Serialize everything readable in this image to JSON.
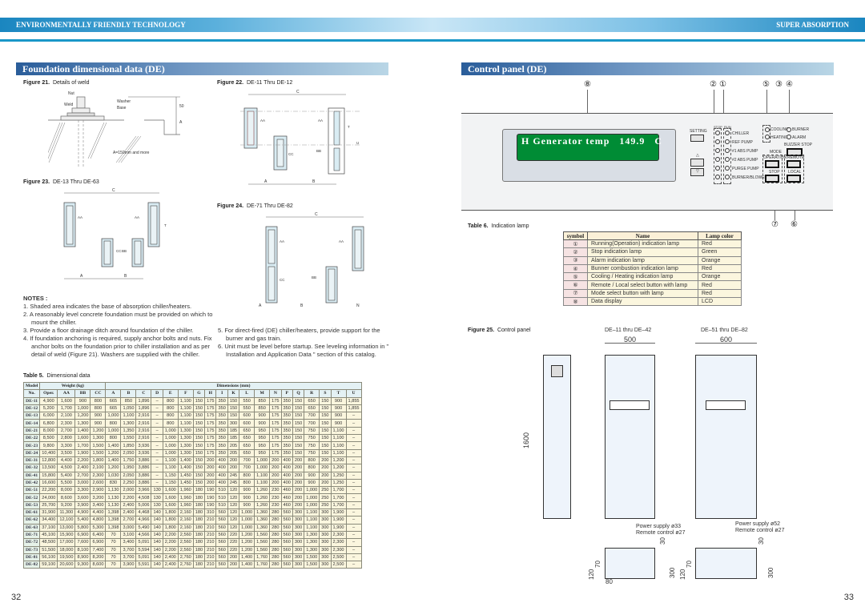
{
  "header": {
    "left_title": "ENVIRONMENTALLY FRIENDLY TECHNOLOGY",
    "right_title": "SUPER ABSORPTION"
  },
  "left_page": {
    "section_title": "Foundation dimensional data (DE)",
    "figures": {
      "fig21": {
        "num": "Figure 21.",
        "caption": "Details of weld",
        "labels": {
          "nut": "Nut",
          "weld": "Weld",
          "washer": "Washer",
          "base": "Base",
          "dim_50": "50",
          "dim_a": "A",
          "note": "A=150mm and more"
        }
      },
      "fig22": {
        "num": "Figure 22.",
        "caption": "DE-11 Thru DE-12"
      },
      "fig23": {
        "num": "Figure 23.",
        "caption": "DE-13 Thru DE-63"
      },
      "fig24": {
        "num": "Figure 24.",
        "caption": "DE-71 Thru DE-82"
      }
    },
    "notes": {
      "heading": "NOTES :",
      "items": [
        "1.  Shaded area indicates the base of absorption chiller/heaters.",
        "2.  A reasonably level concrete foundation must be provided on which to mount the chiller.",
        "3.  Provide a floor drainage ditch around foundation of the chiller.",
        "4.  If foundation anchoring is required, supply anchor bolts and nuts. Fix anchor bolts on the foundation prior to chiller installation and as per detail of weld (Figure 21). Washers are supplied with the chiller.",
        "5.  For direct-fired (DE) chiller/heaters, provide support for the burner and gas train.",
        "6.  Unit must be level before startup. See leveling information in \" Installation and Application Data \" section of this catalog."
      ]
    },
    "table5": {
      "num": "Table 5.",
      "caption": "Dimensional data",
      "group_headers": {
        "model": "Model",
        "model2": "No.",
        "weight": "Weight (kg)",
        "dims": "Dimensions (mm)"
      },
      "columns": [
        "Oper.",
        "AA",
        "BB",
        "CC",
        "A",
        "B",
        "C",
        "D",
        "E",
        "F",
        "G",
        "H",
        "I",
        "K",
        "L",
        "M",
        "N",
        "P",
        "Q",
        "R",
        "S",
        "T",
        "U"
      ],
      "rows": [
        {
          "model": "DE-11",
          "values": [
            "4,900",
            "1,600",
            "900",
            "800",
            "665",
            "850",
            "1,896",
            "–",
            "800",
            "1,100",
            "150",
            "175",
            "350",
            "150",
            "550",
            "850",
            "175",
            "350",
            "150",
            "650",
            "150",
            "900",
            "1,855"
          ]
        },
        {
          "model": "DE-12",
          "values": [
            "5,200",
            "1,700",
            "1,000",
            "800",
            "665",
            "1,050",
            "1,896",
            "–",
            "800",
            "1,100",
            "150",
            "175",
            "350",
            "150",
            "550",
            "850",
            "175",
            "350",
            "150",
            "650",
            "150",
            "900",
            "1,855"
          ]
        },
        {
          "model": "DE-13",
          "values": [
            "6,000",
            "2,100",
            "1,200",
            "900",
            "1,000",
            "1,100",
            "2,916",
            "–",
            "800",
            "1,100",
            "150",
            "175",
            "350",
            "150",
            "600",
            "900",
            "175",
            "350",
            "150",
            "700",
            "150",
            "900",
            "–"
          ]
        },
        {
          "model": "DE-14",
          "values": [
            "6,800",
            "2,300",
            "1,300",
            "900",
            "800",
            "1,300",
            "2,916",
            "–",
            "800",
            "1,100",
            "150",
            "175",
            "350",
            "300",
            "600",
            "900",
            "175",
            "350",
            "150",
            "700",
            "150",
            "900",
            "–"
          ]
        },
        {
          "model": "DE-21",
          "values": [
            "8,000",
            "2,700",
            "1,400",
            "1,200",
            "1,000",
            "1,350",
            "2,916",
            "–",
            "1,000",
            "1,300",
            "150",
            "175",
            "350",
            "185",
            "650",
            "950",
            "175",
            "350",
            "150",
            "750",
            "150",
            "1,100",
            "–"
          ]
        },
        {
          "model": "DE-22",
          "values": [
            "8,500",
            "2,800",
            "1,600",
            "1,300",
            "800",
            "1,550",
            "2,916",
            "–",
            "1,000",
            "1,300",
            "150",
            "175",
            "350",
            "185",
            "650",
            "950",
            "175",
            "350",
            "150",
            "750",
            "150",
            "1,100",
            "–"
          ]
        },
        {
          "model": "DE-23",
          "values": [
            "9,800",
            "3,300",
            "1,700",
            "1,500",
            "1,400",
            "1,850",
            "3,936",
            "–",
            "1,000",
            "1,300",
            "150",
            "175",
            "350",
            "205",
            "650",
            "950",
            "175",
            "350",
            "150",
            "750",
            "150",
            "1,100",
            "–"
          ]
        },
        {
          "model": "DE-24",
          "values": [
            "10,400",
            "3,500",
            "1,900",
            "1,500",
            "1,200",
            "2,050",
            "3,936",
            "–",
            "1,000",
            "1,300",
            "150",
            "175",
            "350",
            "205",
            "650",
            "950",
            "175",
            "350",
            "150",
            "750",
            "150",
            "1,100",
            "–"
          ]
        },
        {
          "model": "DE-31",
          "values": [
            "12,800",
            "4,400",
            "2,200",
            "1,800",
            "1,400",
            "1,750",
            "3,886",
            "–",
            "1,100",
            "1,400",
            "150",
            "200",
            "400",
            "200",
            "700",
            "1,000",
            "200",
            "400",
            "200",
            "800",
            "200",
            "1,200",
            "–"
          ]
        },
        {
          "model": "DE-32",
          "values": [
            "13,500",
            "4,500",
            "2,400",
            "2,100",
            "1,200",
            "1,950",
            "3,886",
            "–",
            "1,100",
            "1,400",
            "150",
            "200",
            "400",
            "200",
            "700",
            "1,000",
            "200",
            "400",
            "200",
            "800",
            "200",
            "1,200",
            "–"
          ]
        },
        {
          "model": "DE-41",
          "values": [
            "15,800",
            "5,400",
            "2,700",
            "2,300",
            "1,030",
            "2,050",
            "3,886",
            "–",
            "1,150",
            "1,450",
            "150",
            "200",
            "400",
            "245",
            "800",
            "1,100",
            "200",
            "400",
            "200",
            "900",
            "200",
            "1,250",
            "–"
          ]
        },
        {
          "model": "DE-42",
          "values": [
            "16,600",
            "5,500",
            "3,000",
            "2,600",
            "830",
            "2,250",
            "3,886",
            "–",
            "1,150",
            "1,450",
            "150",
            "200",
            "400",
            "245",
            "800",
            "1,100",
            "200",
            "400",
            "200",
            "900",
            "200",
            "1,250",
            "–"
          ]
        },
        {
          "model": "DE-51",
          "values": [
            "22,200",
            "8,000",
            "3,300",
            "2,900",
            "1,130",
            "2,000",
            "3,966",
            "130",
            "1,600",
            "1,960",
            "180",
            "190",
            "510",
            "120",
            "900",
            "1,260",
            "230",
            "460",
            "200",
            "1,000",
            "250",
            "1,700",
            "–"
          ]
        },
        {
          "model": "DE-52",
          "values": [
            "24,000",
            "8,600",
            "3,600",
            "3,200",
            "1,130",
            "2,200",
            "4,508",
            "130",
            "1,600",
            "1,960",
            "180",
            "190",
            "510",
            "120",
            "900",
            "1,260",
            "230",
            "460",
            "200",
            "1,000",
            "250",
            "1,700",
            "–"
          ]
        },
        {
          "model": "DE-53",
          "values": [
            "25,700",
            "9,200",
            "3,900",
            "3,400",
            "1,130",
            "2,400",
            "5,006",
            "130",
            "1,600",
            "1,960",
            "180",
            "190",
            "510",
            "120",
            "900",
            "1,260",
            "230",
            "460",
            "200",
            "1,000",
            "250",
            "1,700",
            "–"
          ]
        },
        {
          "model": "DE-61",
          "values": [
            "31,900",
            "11,300",
            "4,900",
            "4,400",
            "1,398",
            "2,400",
            "4,468",
            "140",
            "1,800",
            "2,160",
            "180",
            "310",
            "560",
            "120",
            "1,000",
            "1,360",
            "280",
            "560",
            "300",
            "1,100",
            "300",
            "1,900",
            "–"
          ]
        },
        {
          "model": "DE-62",
          "values": [
            "34,400",
            "12,100",
            "5,400",
            "4,800",
            "1,398",
            "2,700",
            "4,966",
            "140",
            "1,800",
            "2,160",
            "180",
            "210",
            "560",
            "120",
            "1,000",
            "1,360",
            "280",
            "560",
            "300",
            "1,100",
            "300",
            "1,900",
            "–"
          ]
        },
        {
          "model": "DE-63",
          "values": [
            "37,100",
            "13,000",
            "5,800",
            "5,300",
            "1,398",
            "3,000",
            "5,490",
            "140",
            "1,800",
            "2,160",
            "180",
            "210",
            "560",
            "120",
            "1,000",
            "1,360",
            "280",
            "560",
            "300",
            "1,100",
            "300",
            "1,900",
            "–"
          ]
        },
        {
          "model": "DE-71",
          "values": [
            "45,100",
            "15,900",
            "6,900",
            "6,400",
            "70",
            "3,100",
            "4,566",
            "140",
            "2,200",
            "2,560",
            "180",
            "210",
            "560",
            "220",
            "1,200",
            "1,560",
            "280",
            "560",
            "300",
            "1,300",
            "300",
            "2,300",
            "–"
          ]
        },
        {
          "model": "DE-72",
          "values": [
            "48,500",
            "17,000",
            "7,600",
            "6,900",
            "70",
            "3,400",
            "5,091",
            "140",
            "2,200",
            "2,560",
            "180",
            "210",
            "560",
            "220",
            "1,200",
            "1,560",
            "280",
            "560",
            "300",
            "1,300",
            "300",
            "2,300",
            "–"
          ]
        },
        {
          "model": "DE-73",
          "values": [
            "51,500",
            "18,000",
            "8,100",
            "7,400",
            "70",
            "3,700",
            "5,594",
            "140",
            "2,200",
            "2,560",
            "180",
            "210",
            "560",
            "220",
            "1,200",
            "1,560",
            "280",
            "560",
            "300",
            "1,300",
            "300",
            "2,300",
            "–"
          ]
        },
        {
          "model": "DE-81",
          "values": [
            "56,100",
            "19,500",
            "8,900",
            "8,200",
            "70",
            "3,700",
            "5,091",
            "140",
            "2,400",
            "2,760",
            "180",
            "210",
            "560",
            "200",
            "1,400",
            "1,760",
            "280",
            "560",
            "300",
            "1,500",
            "300",
            "2,500",
            "–"
          ]
        },
        {
          "model": "DE-82",
          "values": [
            "59,100",
            "20,600",
            "9,300",
            "8,600",
            "70",
            "3,900",
            "5,591",
            "140",
            "2,400",
            "2,760",
            "180",
            "210",
            "560",
            "200",
            "1,400",
            "1,760",
            "280",
            "560",
            "300",
            "1,500",
            "300",
            "2,500",
            "–"
          ]
        }
      ]
    },
    "page_number": "32"
  },
  "right_page": {
    "section_title": "Control panel (DE)",
    "callouts": {
      "c8": "⑧",
      "c2": "②",
      "c1": "①",
      "c5": "⑤",
      "c3": "③",
      "c4": "④",
      "c7": "⑦",
      "c6": "⑥"
    },
    "panel": {
      "lcd_text": "H Generator temp   149.9   C",
      "setting": "SETTING",
      "up": "△",
      "down": "▽",
      "col_stop": "STOP",
      "col_run": "RUN",
      "run_items": [
        "CHILLER",
        "REF PUMP",
        "#1 ABS PUMP",
        "#2 ABS PUMP",
        "PURGE PUMP",
        "BURNER/BLOWER"
      ],
      "cooling": "COOLING",
      "heating": "HEATING",
      "burner": "BURNER",
      "alarm": "ALARM",
      "buzzer_stop": "BUZZER STOP",
      "mode": "MODE",
      "operation": "OPERATION",
      "stop": "STOP",
      "remote": "REMOTE",
      "local": "LOCAL"
    },
    "table6": {
      "num": "Table 6.",
      "caption": "Indication lamp",
      "headers": [
        "symbol",
        "Name",
        "Lamp color"
      ],
      "rows": [
        {
          "symbol": "①",
          "name": "Running(Operation) indication lamp",
          "color": "Red"
        },
        {
          "symbol": "②",
          "name": "Stop indication lamp",
          "color": "Green"
        },
        {
          "symbol": "③",
          "name": "Alarm indication lamp",
          "color": "Orange"
        },
        {
          "symbol": "④",
          "name": "Bunner combustion indication lamp",
          "color": "Red"
        },
        {
          "symbol": "⑤",
          "name": "Cooling / Heating indication lamp",
          "color": "Orange"
        },
        {
          "symbol": "⑥",
          "name": "Remote / Local select button with lamp",
          "color": "Red"
        },
        {
          "symbol": "⑦",
          "name": "Mode select button with lamp",
          "color": "Red"
        },
        {
          "symbol": "⑧",
          "name": "Data display",
          "color": "LCD"
        }
      ]
    },
    "fig25": {
      "num": "Figure 25.",
      "caption": "Control panel",
      "model_a": "DE–11  thru  DE–42",
      "model_b": "DE–51  thru  DE–82",
      "width_a": "500",
      "width_b": "600",
      "height": "1600",
      "power_a": "Power supply ø33",
      "remote_a": "Remote control ø27",
      "power_b": "Power supply ø52",
      "remote_b": "Remote control ø27",
      "dim_30": "30",
      "dim_300": "300",
      "dim_120": "120",
      "dim_70": "70",
      "dim_80": "80"
    },
    "page_number": "33"
  }
}
